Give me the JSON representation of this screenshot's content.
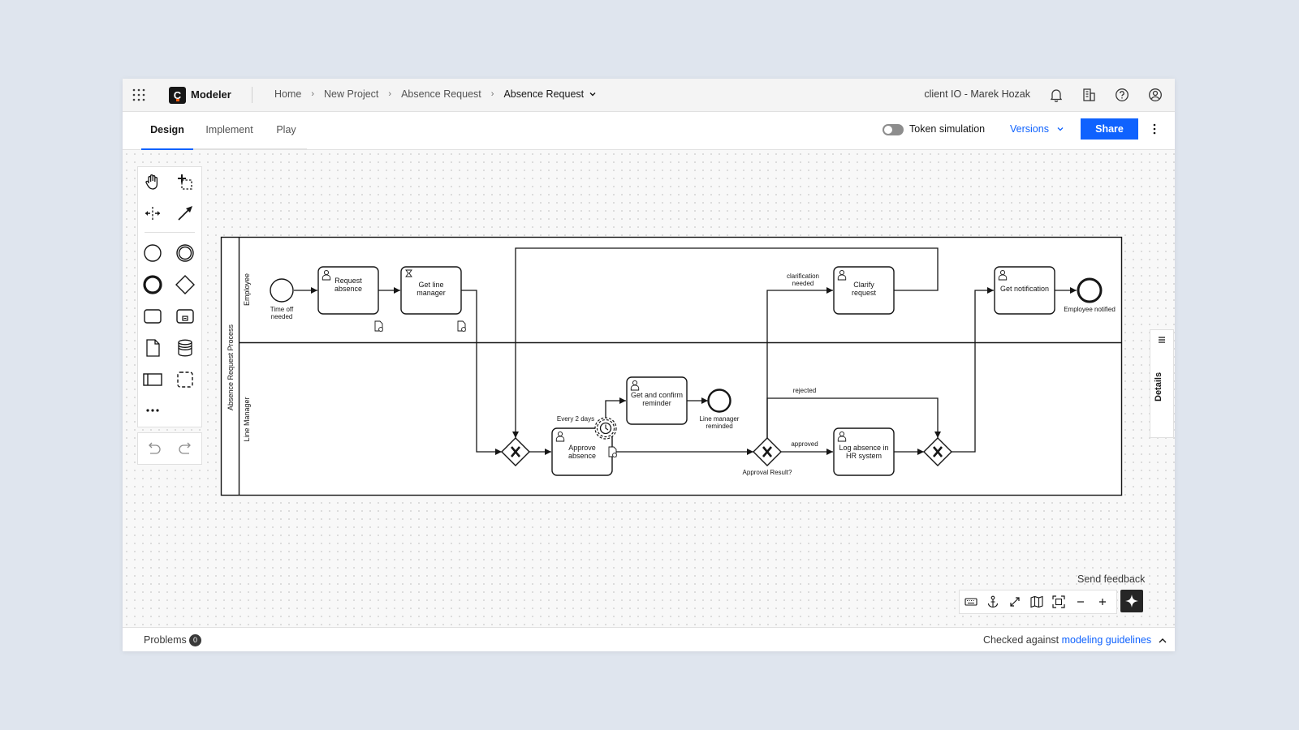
{
  "header": {
    "app_name": "Modeler",
    "logo_letter": "C",
    "breadcrumbs": [
      "Home",
      "New Project",
      "Absence Request"
    ],
    "current_file": "Absence Request",
    "user": "client IO - Marek Hozak",
    "icons": [
      "app-switcher-icon",
      "notification-bell-icon",
      "organization-icon",
      "help-icon",
      "user-profile-icon"
    ]
  },
  "tabs": [
    "Design",
    "Implement",
    "Play"
  ],
  "active_tab": "Design",
  "toolbar": {
    "token_simulation_label": "Token simulation",
    "token_simulation_on": false,
    "versions_label": "Versions",
    "share_label": "Share"
  },
  "palette": {
    "tools": [
      "hand-tool",
      "lasso-tool",
      "space-tool",
      "global-connect-tool",
      "start-event",
      "intermediate-event",
      "end-event",
      "gateway",
      "task",
      "subprocess",
      "data-object",
      "data-store",
      "participant-pool",
      "group",
      "more-tools"
    ],
    "history": [
      "undo",
      "redo"
    ]
  },
  "diagram": {
    "pool": "Absence Request Process",
    "lanes": [
      "Employee",
      "Line Manager"
    ],
    "events": {
      "time_off": "Time off needed",
      "employee_notified": "Employee notified",
      "manager_reminded": "Line manager reminded"
    },
    "tasks": {
      "request_absence": "Request absence",
      "get_line_manager": "Get line manager",
      "clarify_request": "Clarify request",
      "get_notification": "Get notification",
      "approve_absence": "Approve absence",
      "confirm_reminder": "Get and confirm reminder",
      "log_absence": "Log absence in HR system"
    },
    "labels": {
      "timer": "Every 2 days",
      "clarification": "clarification needed",
      "rejected": "rejected",
      "approved": "approved",
      "approval_result": "Approval Result?"
    }
  },
  "side_panel": {
    "details_label": "Details"
  },
  "feedback_label": "Send feedback",
  "status": {
    "problems_label": "Problems",
    "problems_count": "0",
    "checked_prefix": "Checked against",
    "guidelines_link": "modeling guidelines"
  },
  "colors": {
    "accent": "#0f62fe",
    "logo_dot": "#fc5d0d"
  }
}
